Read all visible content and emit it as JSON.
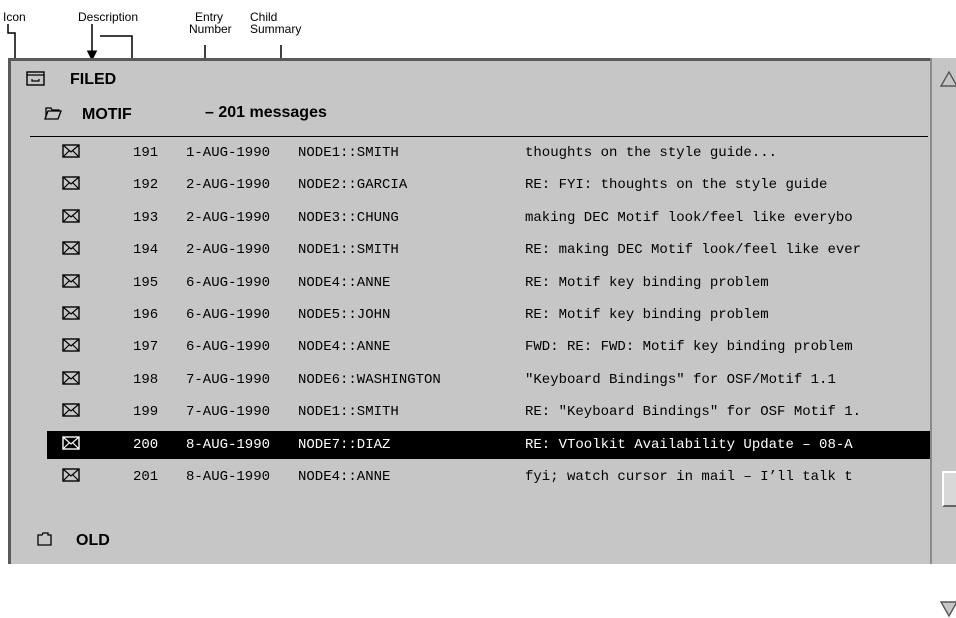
{
  "annotations": {
    "icon": "Icon",
    "description": "Description",
    "entry_number": [
      "Entry",
      "Number"
    ],
    "child_summary": [
      "Child",
      "Summary"
    ]
  },
  "folders": {
    "filed": "FILED",
    "motif": "MOTIF",
    "motif_summary": "– 201 messages",
    "old": "OLD"
  },
  "messages": [
    {
      "num": "191",
      "date": "1-AUG-1990",
      "sender": "NODE1::SMITH",
      "subject": "thoughts on the style guide..."
    },
    {
      "num": "192",
      "date": "2-AUG-1990",
      "sender": "NODE2::GARCIA",
      "subject": "RE: FYI: thoughts on the style guide"
    },
    {
      "num": "193",
      "date": "2-AUG-1990",
      "sender": "NODE3::CHUNG",
      "subject": "making DEC Motif look/feel like everybo"
    },
    {
      "num": "194",
      "date": "2-AUG-1990",
      "sender": "NODE1::SMITH",
      "subject": "RE: making DEC Motif look/feel like ever"
    },
    {
      "num": "195",
      "date": "6-AUG-1990",
      "sender": "NODE4::ANNE",
      "subject": "RE: Motif key binding problem"
    },
    {
      "num": "196",
      "date": "6-AUG-1990",
      "sender": "NODE5::JOHN",
      "subject": "RE: Motif key binding problem"
    },
    {
      "num": "197",
      "date": "6-AUG-1990",
      "sender": "NODE4::ANNE",
      "subject": "FWD: RE: FWD: Motif key binding problem"
    },
    {
      "num": "198",
      "date": "7-AUG-1990",
      "sender": "NODE6::WASHINGTON",
      "subject": "\"Keyboard Bindings\" for OSF/Motif 1.1"
    },
    {
      "num": "199",
      "date": "7-AUG-1990",
      "sender": "NODE1::SMITH",
      "subject": "RE: \"Keyboard Bindings\" for OSF Motif 1."
    },
    {
      "num": "200",
      "date": "8-AUG-1990",
      "sender": "NODE7::DIAZ",
      "subject": "RE: VToolkit Availability Update – 08-A",
      "selected": true
    },
    {
      "num": "201",
      "date": "8-AUG-1990",
      "sender": "NODE4::ANNE",
      "subject": "fyi; watch cursor in mail – I’ll talk t"
    }
  ],
  "icons": {
    "filed": "filed-drawer-icon",
    "motif": "open-folder-icon",
    "old": "closed-folder-icon",
    "message": "envelope-icon",
    "scroll_up": "scroll-up-arrow-icon",
    "scroll_down": "scroll-down-arrow-icon"
  }
}
